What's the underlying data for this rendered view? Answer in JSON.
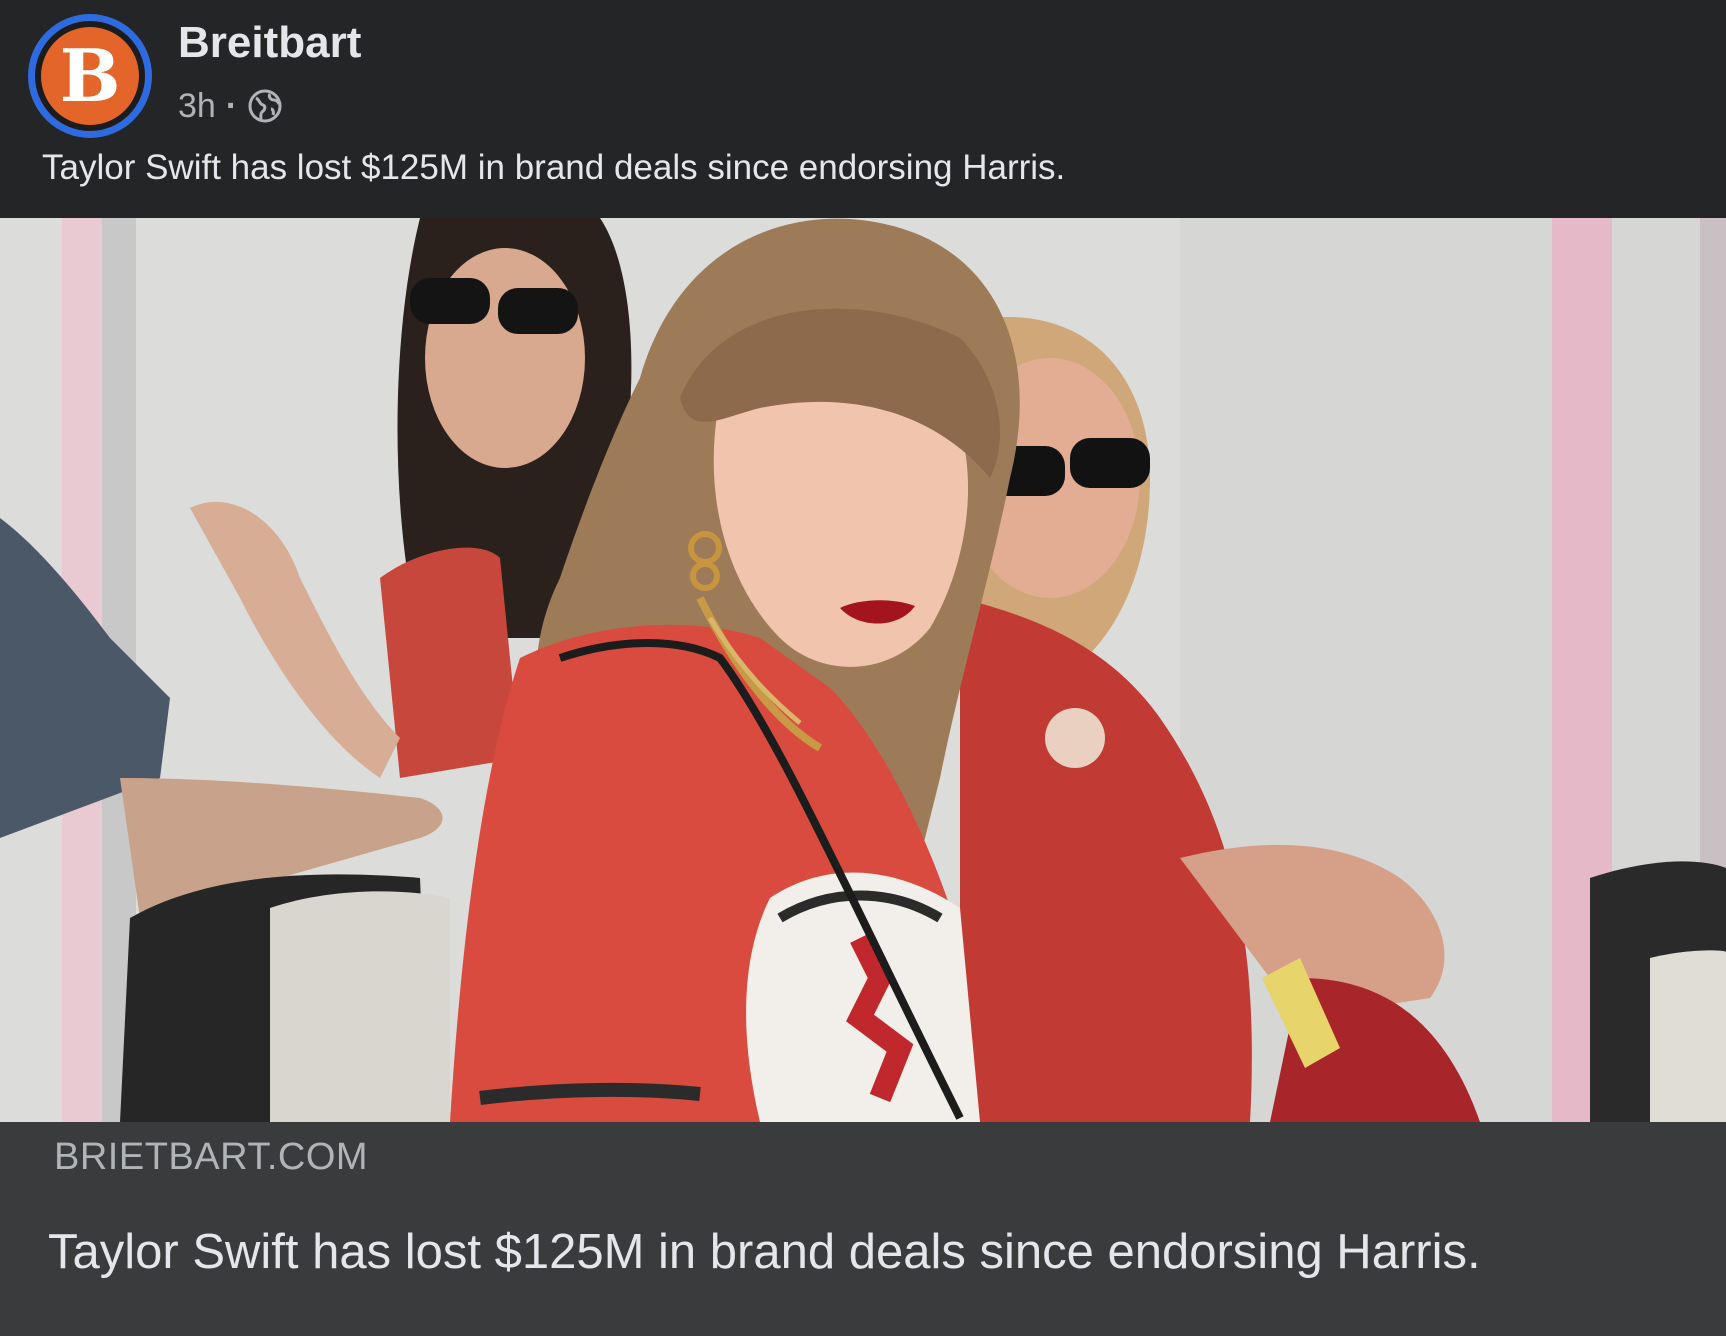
{
  "post": {
    "page_name": "Breitbart",
    "avatar_letter": "B",
    "timestamp": "3h",
    "separator": "·",
    "audience_icon": "globe-icon",
    "caption": "Taylor Swift has lost $125M in brand deals since endorsing Harris."
  },
  "link_preview": {
    "domain": "BRIETBART.COM",
    "headline": "Taylor Swift has lost $125M in brand deals since endorsing Harris."
  },
  "colors": {
    "background": "#242526",
    "link_bar": "#3a3b3c",
    "avatar_ring": "#2f6be0",
    "avatar_fill": "#e3652a",
    "text_primary": "#e4e6eb",
    "text_secondary": "#b0b3b8"
  }
}
